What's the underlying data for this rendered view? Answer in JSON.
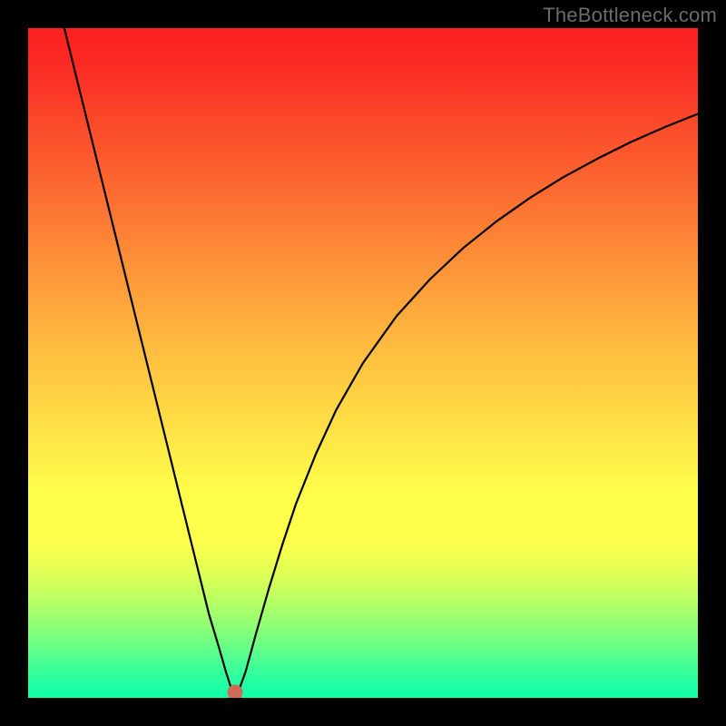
{
  "watermark": "TheBottleneck.com",
  "colors": {
    "background": "#000000",
    "curve": "#000000",
    "dot": "#cf6a57",
    "gradient_top": "#fb2020",
    "gradient_bottom": "#13ffaa"
  },
  "chart_data": {
    "type": "line",
    "title": "",
    "xlabel": "",
    "ylabel": "",
    "xlim": [
      0,
      100
    ],
    "ylim": [
      0,
      100
    ],
    "annotations": [],
    "marker": {
      "x": 30.9,
      "y": 0.8
    },
    "series": [
      {
        "name": "bottleneck-curve",
        "x": [
          5.4,
          7,
          9,
          11,
          13,
          15,
          17,
          19,
          21,
          23,
          25,
          27,
          28.5,
          29.5,
          30.2,
          30.9,
          31.6,
          32.5,
          34,
          36,
          38,
          40,
          43,
          46,
          50,
          55,
          60,
          65,
          70,
          75,
          80,
          85,
          90,
          95,
          100
        ],
        "y": [
          100,
          93.5,
          85.4,
          77.3,
          69.2,
          61.1,
          53,
          44.9,
          36.8,
          28.7,
          20.6,
          12.5,
          7.5,
          4,
          1.8,
          0.5,
          1.5,
          4,
          9.5,
          16.5,
          23,
          29,
          36.5,
          43,
          50,
          57,
          62.5,
          67.2,
          71.2,
          74.7,
          77.8,
          80.5,
          83,
          85.2,
          87.2
        ]
      }
    ]
  }
}
